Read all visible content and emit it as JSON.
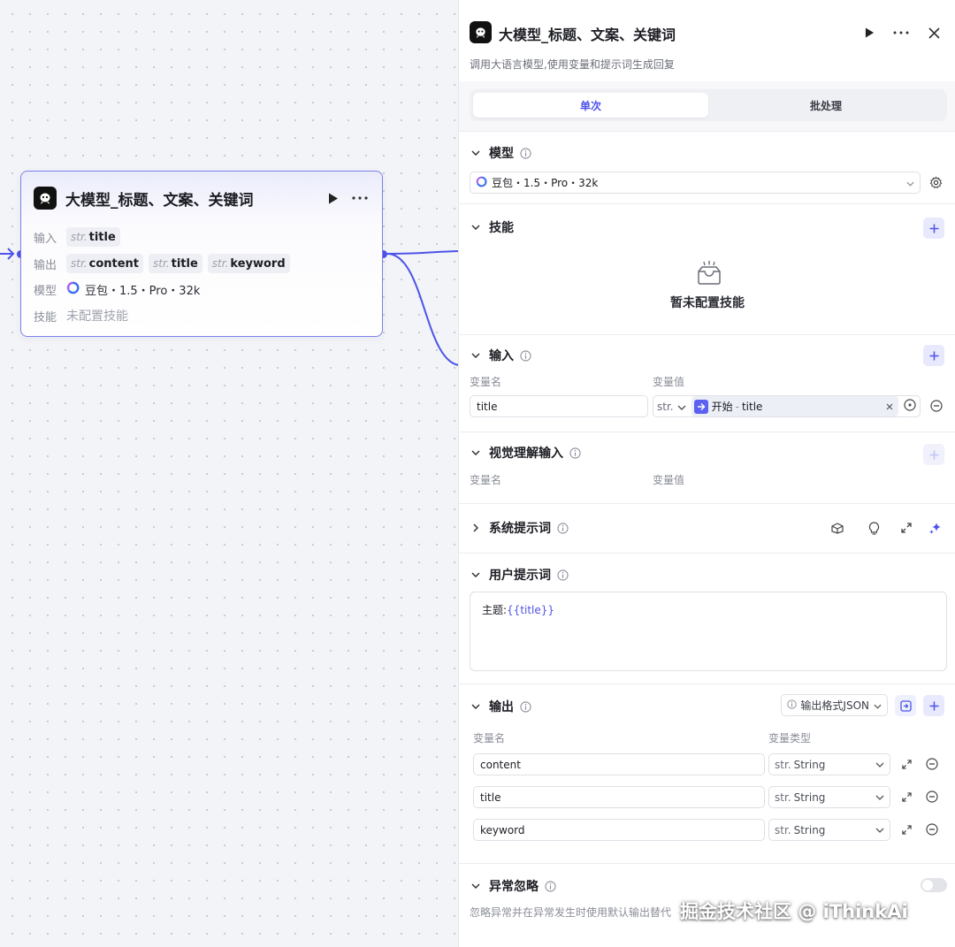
{
  "node": {
    "title": "大模型_标题、文案、关键词",
    "input_label": "输入",
    "inputs": [
      {
        "type": "str.",
        "name": "title"
      }
    ],
    "output_label": "输出",
    "outputs": [
      {
        "type": "str.",
        "name": "content"
      },
      {
        "type": "str.",
        "name": "title"
      },
      {
        "type": "str.",
        "name": "keyword"
      }
    ],
    "model_label": "模型",
    "model_value": "豆包・1.5・Pro・32k",
    "skill_label": "技能",
    "skill_value": "未配置技能"
  },
  "panel": {
    "title": "大模型_标题、文案、关键词",
    "description": "调用大语言模型,使用变量和提示词生成回复",
    "tabs": [
      {
        "label": "单次",
        "active": true
      },
      {
        "label": "批处理",
        "active": false
      }
    ],
    "model": {
      "title": "模型",
      "value": "豆包・1.5・Pro・32k"
    },
    "skills": {
      "title": "技能",
      "empty_text": "暂未配置技能"
    },
    "input": {
      "title": "输入",
      "col_name": "变量名",
      "col_value": "变量值",
      "rows": [
        {
          "name": "title",
          "type": "str.",
          "ref_node": "开始",
          "ref_sep": "-",
          "ref_var": "title"
        }
      ]
    },
    "vision_input": {
      "title": "视觉理解输入",
      "col_name": "变量名",
      "col_value": "变量值"
    },
    "system_prompt": {
      "title": "系统提示词"
    },
    "user_prompt": {
      "title": "用户提示词",
      "prefix": "主题:",
      "var": "{{title}}"
    },
    "output": {
      "title": "输出",
      "format_label": "输出格式JSON",
      "col_name": "变量名",
      "col_type": "变量类型",
      "rows": [
        {
          "name": "content",
          "type_prefix": "str.",
          "type": "String"
        },
        {
          "name": "title",
          "type_prefix": "str.",
          "type": "String"
        },
        {
          "name": "keyword",
          "type_prefix": "str.",
          "type": "String"
        }
      ]
    },
    "exception": {
      "title": "异常忽略",
      "description": "忽略异常并在异常发生时使用默认输出替代",
      "enabled": false
    }
  },
  "watermark": "掘金技术社区 @ iThinkAi",
  "colors": {
    "accent": "#4d53e8",
    "edge": "#4d53e8",
    "border": "#7b82e8"
  },
  "icons": {
    "node_logo": "bot-icon",
    "run": "play-icon",
    "more": "more-icon",
    "close": "close-icon",
    "model": "doubao-icon",
    "settings": "gear-icon",
    "empty": "empty-box-icon"
  }
}
